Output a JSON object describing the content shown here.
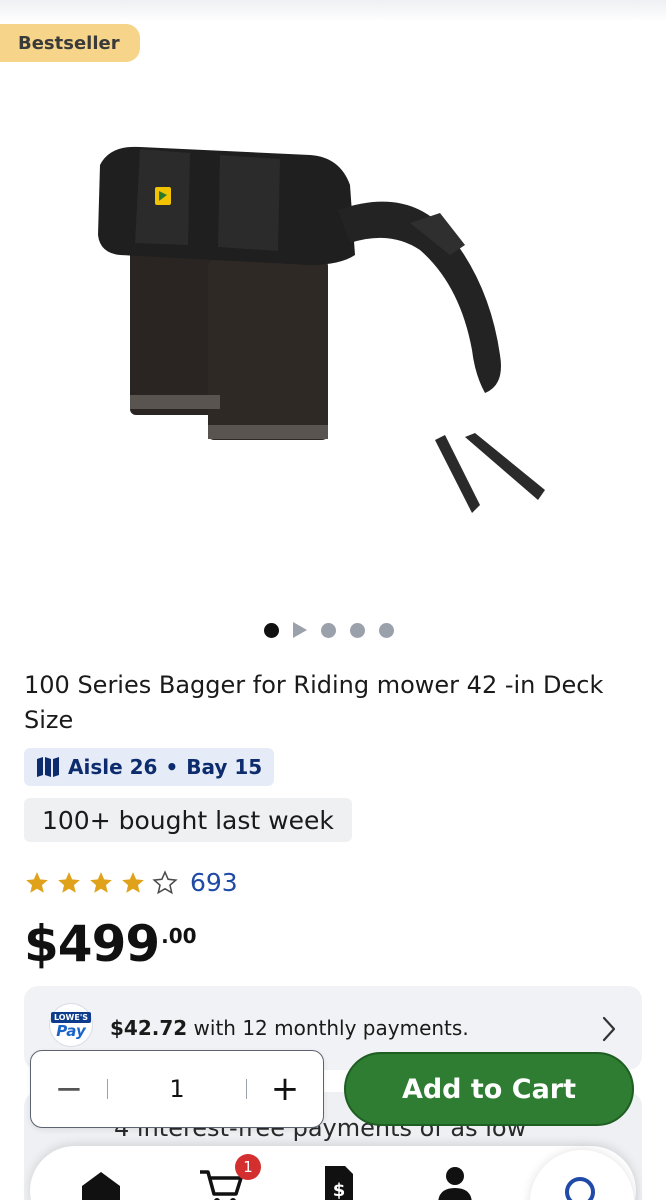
{
  "badge": {
    "label": "Bestseller"
  },
  "product": {
    "title": "100 Series Bagger for Riding mower 42 -in Deck Size",
    "aisle": "Aisle 26",
    "bay": "Bay 15",
    "bought": "100+ bought last week",
    "rating": 3.5,
    "reviews": "693",
    "price_main": "$499",
    "price_cents": ".00"
  },
  "carousel": {
    "slides": 5,
    "active": 0,
    "video_index": 1
  },
  "pay": {
    "logo_top": "LOWE'S",
    "logo_bottom": "Pay",
    "amount": "$42.72",
    "text": " with 12 monthly payments."
  },
  "interest": {
    "text": "4 interest-free payments of as low"
  },
  "quantity": {
    "minus": "−",
    "value": "1",
    "plus": "+"
  },
  "cta": {
    "add_to_cart": "Add to Cart"
  },
  "nav": {
    "cart_count": "1",
    "icons": [
      "home-icon",
      "cart-icon",
      "bill-icon",
      "account-icon",
      "search-icon"
    ]
  },
  "colors": {
    "accent_green": "#2e7d32",
    "badge_yellow": "#f6d58a",
    "link_blue": "#1f4aa6",
    "aisle_chip": "#e6ecf7",
    "star_gold": "#e0a21b"
  }
}
